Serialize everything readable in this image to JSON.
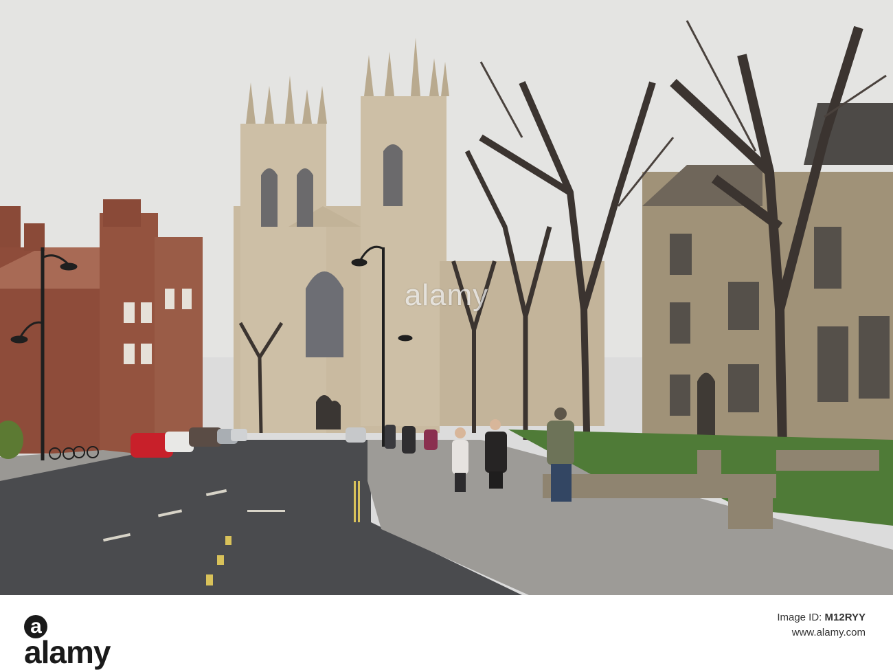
{
  "photo": {
    "subject": "cathedral-street-scene"
  },
  "watermark": {
    "text": "alamy"
  },
  "footer": {
    "logo_text": "alamy",
    "image_id": "M12RYY",
    "site": "www.alamy.com",
    "id_label": "Image ID:"
  },
  "colors": {
    "sky": "#e3e3e1",
    "stone": "#c8b9a0",
    "brick": "#8a4a38",
    "road": "#4a4b4d",
    "pavement": "#9c9a96",
    "grass": "#4e7a36"
  }
}
